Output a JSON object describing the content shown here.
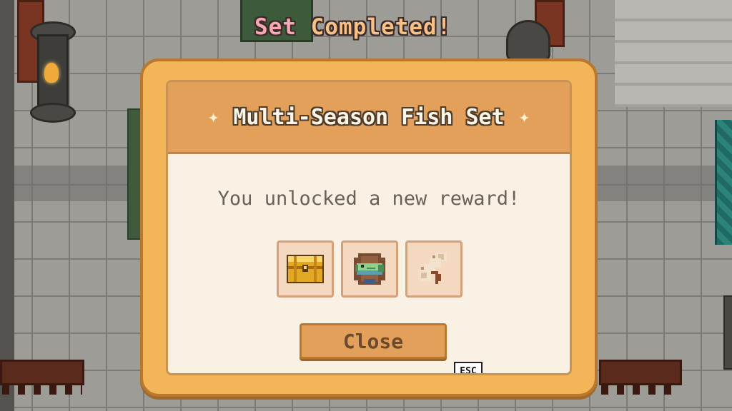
{
  "notice": {
    "word1": "Set",
    "word2": "Completed!"
  },
  "dialog": {
    "title": "Multi-Season Fish Set",
    "sparkle_icon": "✦",
    "message": "You unlocked a new reward!",
    "rewards": [
      {
        "icon": "treasure-chest-icon"
      },
      {
        "icon": "fish-icon"
      },
      {
        "icon": "scroll-icon"
      }
    ],
    "close_label": "Close",
    "close_hotkey": "ESC"
  },
  "colors": {
    "frame": "#f2b659",
    "header": "#e2a05a",
    "panel": "#f8f1e4",
    "notice_pink": "#f6a7b2",
    "notice_orange": "#f7c087"
  }
}
